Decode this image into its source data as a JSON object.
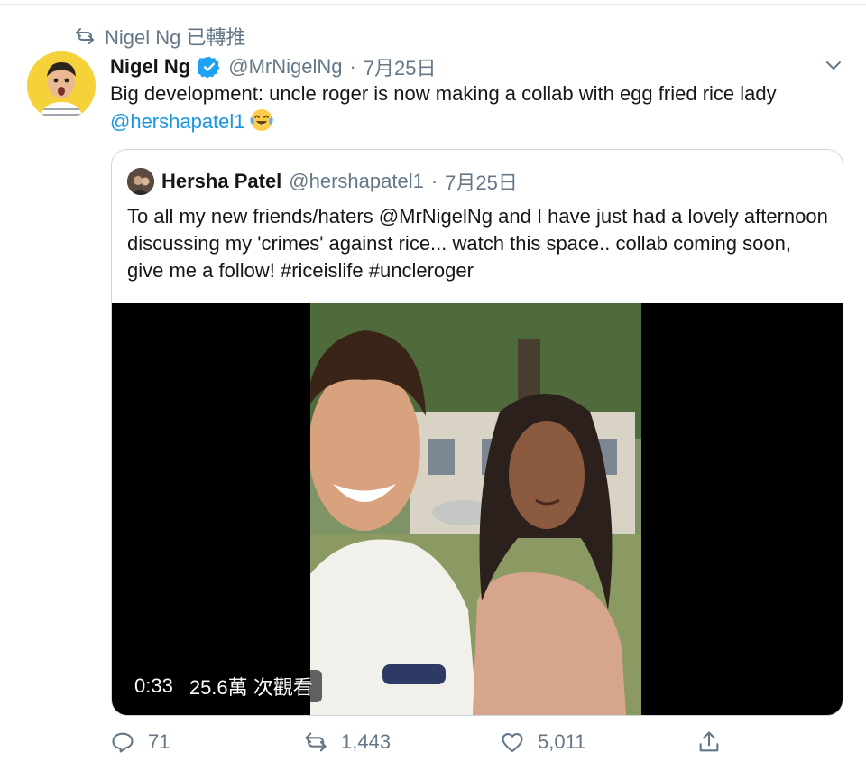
{
  "retweet_context": {
    "text": "Nigel Ng 已轉推"
  },
  "tweet": {
    "author_name": "Nigel Ng",
    "handle": "@MrNigelNg",
    "separator": "·",
    "date": "7月25日",
    "text_prefix": "Big development: uncle roger is now making a collab with egg fried rice lady ",
    "mention": "@hershapatel1",
    "emoji_icon": "face-with-tears-of-joy-icon"
  },
  "quote": {
    "author_name": "Hersha Patel",
    "handle": "@hershapatel1",
    "separator": "·",
    "date": "7月25日",
    "text": "To all my new friends/haters @MrNigelNg and I have just had a lovely afternoon discussing my 'crimes' against rice... watch this space.. collab coming soon, give me a follow! #riceislife #uncleroger",
    "video": {
      "duration": "0:33",
      "views": "25.6萬 次觀看"
    }
  },
  "actions": {
    "reply_count": "71",
    "retweet_count": "1,443",
    "like_count": "5,011"
  },
  "colors": {
    "accent": "#1b95e0",
    "muted": "#657786",
    "border": "#ccd6dd"
  }
}
